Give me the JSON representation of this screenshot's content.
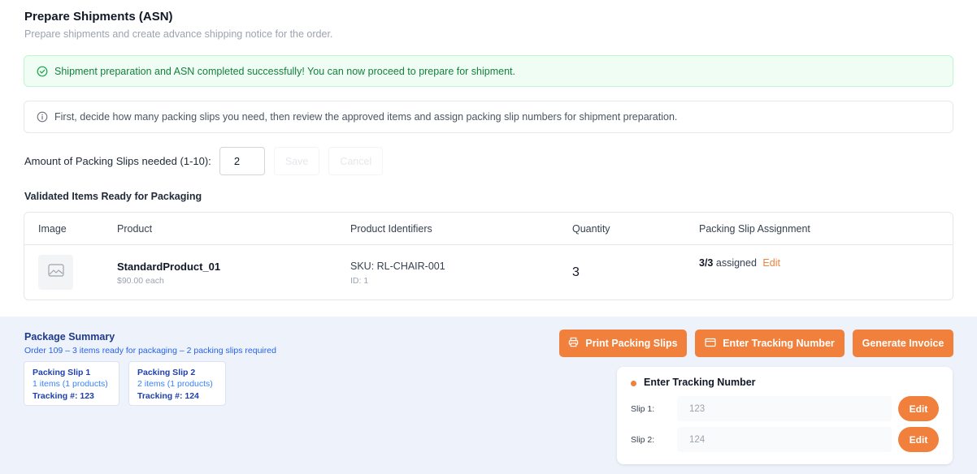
{
  "header": {
    "title": "Prepare Shipments (ASN)",
    "subtitle": "Prepare shipments and create advance shipping notice for the order."
  },
  "alerts": {
    "success": "Shipment preparation and ASN completed successfully! You can now proceed to prepare for shipment.",
    "info": "First, decide how many packing slips you need, then review the approved items and assign packing slip numbers for shipment preparation."
  },
  "slips_form": {
    "label": "Amount of Packing Slips needed (1-10):",
    "value": "2",
    "save_label": "Save",
    "cancel_label": "Cancel"
  },
  "items_section": {
    "title": "Validated Items Ready for Packaging",
    "columns": [
      "Image",
      "Product",
      "Product Identifiers",
      "Quantity",
      "Packing Slip Assignment"
    ],
    "rows": [
      {
        "product_name": "StandardProduct_01",
        "price": "$90.00 each",
        "sku": "SKU: RL-CHAIR-001",
        "id": "ID: 1",
        "quantity": "3",
        "assigned_count": "3/3",
        "assigned_suffix": "assigned",
        "edit_label": "Edit"
      }
    ]
  },
  "summary": {
    "title": "Package Summary",
    "subtitle": "Order 109 – 3 items ready for packaging – 2 packing slips required",
    "slips": [
      {
        "title": "Packing Slip 1",
        "items": "1 items (1 products)",
        "tracking": "Tracking #: 123"
      },
      {
        "title": "Packing Slip 2",
        "items": "2 items (1 products)",
        "tracking": "Tracking #: 124"
      }
    ]
  },
  "actions": {
    "print_label": "Print Packing Slips",
    "tracking_label": "Enter Tracking Number",
    "invoice_label": "Generate Invoice"
  },
  "tracking_panel": {
    "title": "Enter Tracking Number",
    "rows": [
      {
        "label": "Slip 1:",
        "value": "123",
        "edit_label": "Edit"
      },
      {
        "label": "Slip 2:",
        "value": "124",
        "edit_label": "Edit"
      }
    ]
  },
  "colors": {
    "accent": "#f0803c",
    "success_text": "#15803d",
    "summary_bg": "#eef2fb"
  }
}
